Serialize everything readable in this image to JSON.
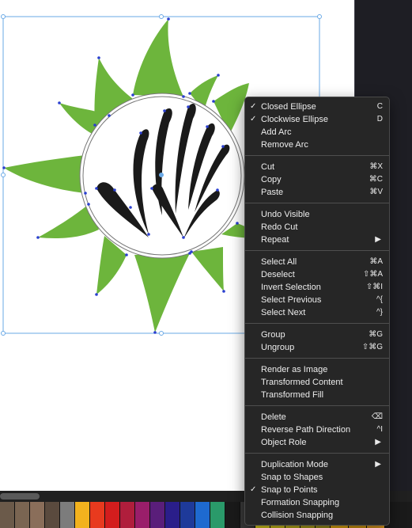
{
  "colors": {
    "leaf_green": "#6db53c",
    "hand_black": "#1a1a1a",
    "selection_blue": "#6aa9e6",
    "menu_bg": "#262626",
    "panel_dark": "#1e1e24"
  },
  "icons": {
    "checkmark": "✓",
    "submenu_arrow": "▶"
  },
  "context_menu": {
    "groups": [
      [
        {
          "label": "Closed Ellipse",
          "checked": true,
          "shortcut": "C"
        },
        {
          "label": "Clockwise Ellipse",
          "checked": true,
          "shortcut": "D"
        },
        {
          "label": "Add Arc"
        },
        {
          "label": "Remove Arc"
        }
      ],
      [
        {
          "label": "Cut",
          "shortcut": "⌘X"
        },
        {
          "label": "Copy",
          "shortcut": "⌘C"
        },
        {
          "label": "Paste",
          "shortcut": "⌘V"
        }
      ],
      [
        {
          "label": "Undo Visible"
        },
        {
          "label": "Redo Cut"
        },
        {
          "label": "Repeat",
          "submenu": true
        }
      ],
      [
        {
          "label": "Select All",
          "shortcut": "⌘A"
        },
        {
          "label": "Deselect",
          "shortcut": "⇧⌘A"
        },
        {
          "label": "Invert Selection",
          "shortcut": "⇧⌘I"
        },
        {
          "label": "Select Previous",
          "shortcut": "^{"
        },
        {
          "label": "Select Next",
          "shortcut": "^}"
        }
      ],
      [
        {
          "label": "Group",
          "shortcut": "⌘G"
        },
        {
          "label": "Ungroup",
          "shortcut": "⇧⌘G"
        }
      ],
      [
        {
          "label": "Render as Image"
        },
        {
          "label": "Transformed Content"
        },
        {
          "label": "Transformed Fill"
        }
      ],
      [
        {
          "label": "Delete",
          "shortcut": "⌫"
        },
        {
          "label": "Reverse Path Direction",
          "shortcut": "^I"
        },
        {
          "label": "Object Role",
          "submenu": true
        }
      ],
      [
        {
          "label": "Duplication Mode",
          "submenu": true
        },
        {
          "label": "Snap to Shapes"
        },
        {
          "label": "Snap to Points",
          "checked": true
        },
        {
          "label": "Formation Snapping"
        },
        {
          "label": "Collision Snapping"
        }
      ]
    ]
  },
  "palette": {
    "colors": [
      "#6b5a4a",
      "#7a6552",
      "#8a6e5a",
      "#5a4a3e",
      "#7c7c7c",
      "#f2b21e",
      "#e83a1e",
      "#d31d1d",
      "#b01e3c",
      "#9a1e6a",
      "#5a1e7a",
      "#2a1e8a",
      "#1e3a9a",
      "#1e6ad0",
      "#2a9a6a",
      "#1a1a1a",
      "#3a3a3a",
      "#e8d81e",
      "#d8c81a",
      "#c8b81a",
      "#b8a81a",
      "#a8981a",
      "#f0b010",
      "#e0a010",
      "#e8a020"
    ]
  }
}
